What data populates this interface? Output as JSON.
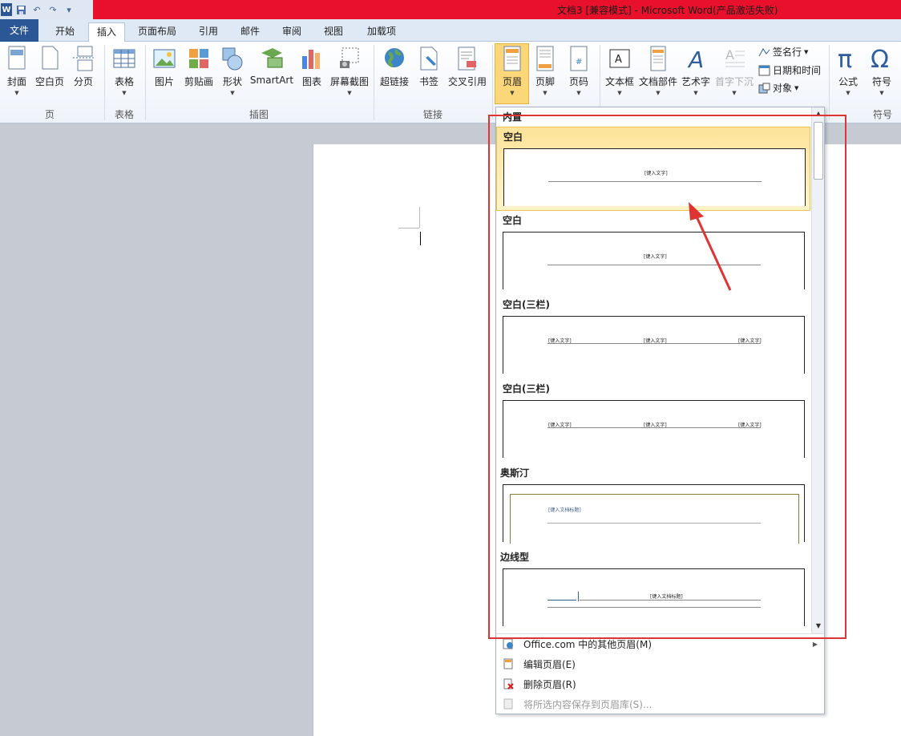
{
  "window": {
    "title": "文档3 [兼容模式] - Microsoft Word(产品激活失败)",
    "app_logo": "W"
  },
  "tabs": [
    "文件",
    "开始",
    "插入",
    "页面布局",
    "引用",
    "邮件",
    "审阅",
    "视图",
    "加载项"
  ],
  "ribbon": {
    "page_group": {
      "label": "页",
      "buttons": [
        "封面",
        "空白页",
        "分页"
      ]
    },
    "table_group": {
      "label": "表格",
      "buttons": [
        "表格"
      ]
    },
    "illus_group": {
      "label": "插图",
      "buttons": [
        "图片",
        "剪贴画",
        "形状",
        "SmartArt",
        "图表",
        "屏幕截图"
      ]
    },
    "links_group": {
      "label": "链接",
      "buttons": [
        "超链接",
        "书签",
        "交叉引用"
      ]
    },
    "hf_group": {
      "buttons": [
        "页眉",
        "页脚",
        "页码"
      ]
    },
    "text_group": {
      "buttons": [
        "文本框",
        "文档部件",
        "艺术字",
        "首字下沉"
      ],
      "small": [
        "签名行",
        "日期和时间",
        "对象"
      ]
    },
    "symbol_group": {
      "label": "符号",
      "buttons": [
        "公式",
        "符号"
      ]
    }
  },
  "gallery": {
    "header": "内置",
    "items": [
      {
        "title": "空白",
        "placeholders": [
          "[键入文字]"
        ]
      },
      {
        "title": "空白",
        "placeholders": [
          "[键入文字]"
        ]
      },
      {
        "title": "空白(三栏)",
        "placeholders": [
          "[键入文字]",
          "[键入文字]",
          "[键入文字]"
        ]
      },
      {
        "title": "空白(三栏)",
        "placeholders": [
          "[键入文字]",
          "[键入文字]",
          "[键入文字]"
        ]
      },
      {
        "title": "奥斯汀",
        "placeholders": [
          "[键入文档标题]"
        ]
      },
      {
        "title": "边线型",
        "placeholders": [
          "[键入文档标题]"
        ]
      }
    ]
  },
  "menu": {
    "more": "Office.com 中的其他页眉(M)",
    "edit": "编辑页眉(E)",
    "remove": "删除页眉(R)",
    "save": "将所选内容保存到页眉库(S)..."
  },
  "colors": {
    "titlebar": "#e8102a",
    "file_tab": "#2b5797",
    "highlight": "#fbd77a",
    "annotation": "#e03434"
  }
}
